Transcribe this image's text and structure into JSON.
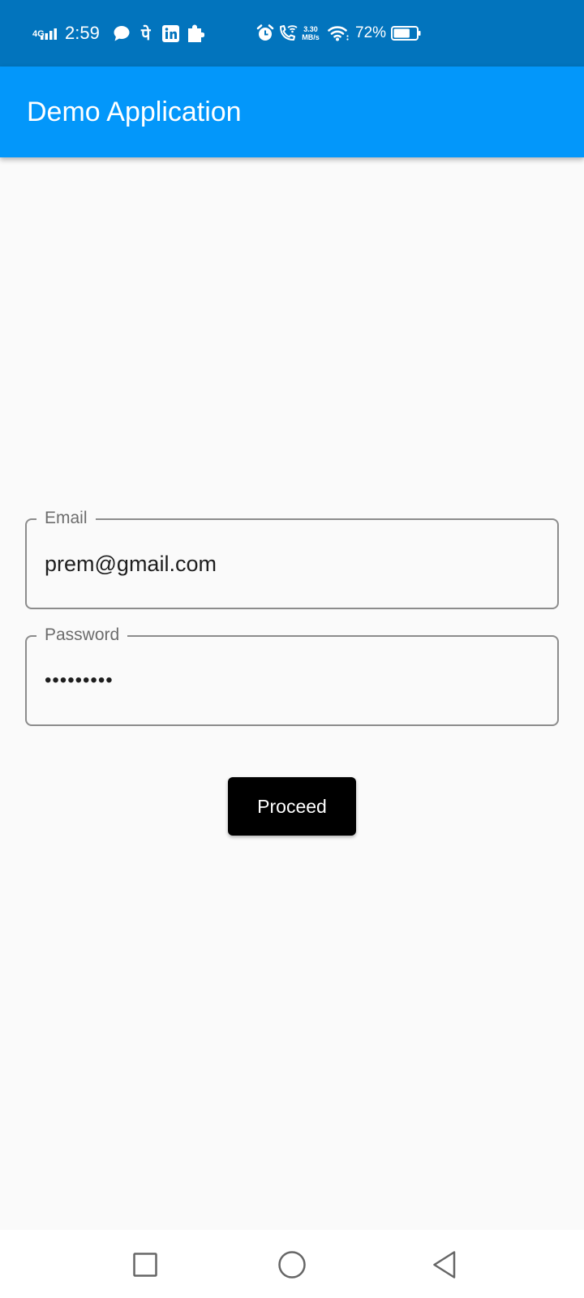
{
  "status_bar": {
    "network_type": "4G",
    "time": "2:59",
    "devanagari_glyph": "पे",
    "net_speed_value": "3.30",
    "net_speed_unit": "MB/s",
    "battery_percent": "72%",
    "battery_level_fraction": 0.72,
    "background_color": "#0274bd",
    "icons": [
      "signal-icon",
      "chat-icon",
      "linkedin-icon",
      "puzzle-icon",
      "alarm-icon",
      "wifi-call-icon",
      "wifi-icon",
      "battery-icon"
    ]
  },
  "app_bar": {
    "title": "Demo Application",
    "background_color": "#0397fa"
  },
  "form": {
    "email": {
      "label": "Email",
      "value": "prem@gmail.com"
    },
    "password": {
      "label": "Password",
      "value": "•••••••••"
    },
    "submit_label": "Proceed"
  },
  "nav_bar": {
    "icons": [
      "recents-icon",
      "home-icon",
      "back-icon"
    ]
  },
  "colors": {
    "page_background": "#fafafa",
    "button_background": "#000000",
    "field_border": "#8c8c8c"
  }
}
